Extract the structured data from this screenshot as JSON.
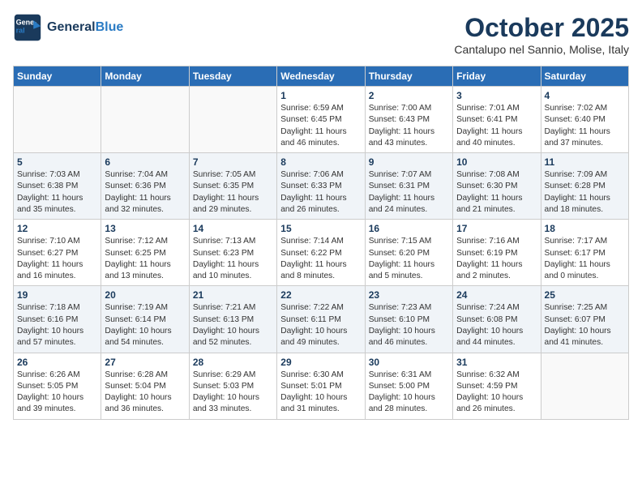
{
  "header": {
    "logo_line1": "General",
    "logo_line2": "Blue",
    "month": "October 2025",
    "location": "Cantalupo nel Sannio, Molise, Italy"
  },
  "weekdays": [
    "Sunday",
    "Monday",
    "Tuesday",
    "Wednesday",
    "Thursday",
    "Friday",
    "Saturday"
  ],
  "weeks": [
    [
      {
        "day": "",
        "detail": ""
      },
      {
        "day": "",
        "detail": ""
      },
      {
        "day": "",
        "detail": ""
      },
      {
        "day": "1",
        "detail": "Sunrise: 6:59 AM\nSunset: 6:45 PM\nDaylight: 11 hours\nand 46 minutes."
      },
      {
        "day": "2",
        "detail": "Sunrise: 7:00 AM\nSunset: 6:43 PM\nDaylight: 11 hours\nand 43 minutes."
      },
      {
        "day": "3",
        "detail": "Sunrise: 7:01 AM\nSunset: 6:41 PM\nDaylight: 11 hours\nand 40 minutes."
      },
      {
        "day": "4",
        "detail": "Sunrise: 7:02 AM\nSunset: 6:40 PM\nDaylight: 11 hours\nand 37 minutes."
      }
    ],
    [
      {
        "day": "5",
        "detail": "Sunrise: 7:03 AM\nSunset: 6:38 PM\nDaylight: 11 hours\nand 35 minutes."
      },
      {
        "day": "6",
        "detail": "Sunrise: 7:04 AM\nSunset: 6:36 PM\nDaylight: 11 hours\nand 32 minutes."
      },
      {
        "day": "7",
        "detail": "Sunrise: 7:05 AM\nSunset: 6:35 PM\nDaylight: 11 hours\nand 29 minutes."
      },
      {
        "day": "8",
        "detail": "Sunrise: 7:06 AM\nSunset: 6:33 PM\nDaylight: 11 hours\nand 26 minutes."
      },
      {
        "day": "9",
        "detail": "Sunrise: 7:07 AM\nSunset: 6:31 PM\nDaylight: 11 hours\nand 24 minutes."
      },
      {
        "day": "10",
        "detail": "Sunrise: 7:08 AM\nSunset: 6:30 PM\nDaylight: 11 hours\nand 21 minutes."
      },
      {
        "day": "11",
        "detail": "Sunrise: 7:09 AM\nSunset: 6:28 PM\nDaylight: 11 hours\nand 18 minutes."
      }
    ],
    [
      {
        "day": "12",
        "detail": "Sunrise: 7:10 AM\nSunset: 6:27 PM\nDaylight: 11 hours\nand 16 minutes."
      },
      {
        "day": "13",
        "detail": "Sunrise: 7:12 AM\nSunset: 6:25 PM\nDaylight: 11 hours\nand 13 minutes."
      },
      {
        "day": "14",
        "detail": "Sunrise: 7:13 AM\nSunset: 6:23 PM\nDaylight: 11 hours\nand 10 minutes."
      },
      {
        "day": "15",
        "detail": "Sunrise: 7:14 AM\nSunset: 6:22 PM\nDaylight: 11 hours\nand 8 minutes."
      },
      {
        "day": "16",
        "detail": "Sunrise: 7:15 AM\nSunset: 6:20 PM\nDaylight: 11 hours\nand 5 minutes."
      },
      {
        "day": "17",
        "detail": "Sunrise: 7:16 AM\nSunset: 6:19 PM\nDaylight: 11 hours\nand 2 minutes."
      },
      {
        "day": "18",
        "detail": "Sunrise: 7:17 AM\nSunset: 6:17 PM\nDaylight: 11 hours\nand 0 minutes."
      }
    ],
    [
      {
        "day": "19",
        "detail": "Sunrise: 7:18 AM\nSunset: 6:16 PM\nDaylight: 10 hours\nand 57 minutes."
      },
      {
        "day": "20",
        "detail": "Sunrise: 7:19 AM\nSunset: 6:14 PM\nDaylight: 10 hours\nand 54 minutes."
      },
      {
        "day": "21",
        "detail": "Sunrise: 7:21 AM\nSunset: 6:13 PM\nDaylight: 10 hours\nand 52 minutes."
      },
      {
        "day": "22",
        "detail": "Sunrise: 7:22 AM\nSunset: 6:11 PM\nDaylight: 10 hours\nand 49 minutes."
      },
      {
        "day": "23",
        "detail": "Sunrise: 7:23 AM\nSunset: 6:10 PM\nDaylight: 10 hours\nand 46 minutes."
      },
      {
        "day": "24",
        "detail": "Sunrise: 7:24 AM\nSunset: 6:08 PM\nDaylight: 10 hours\nand 44 minutes."
      },
      {
        "day": "25",
        "detail": "Sunrise: 7:25 AM\nSunset: 6:07 PM\nDaylight: 10 hours\nand 41 minutes."
      }
    ],
    [
      {
        "day": "26",
        "detail": "Sunrise: 6:26 AM\nSunset: 5:05 PM\nDaylight: 10 hours\nand 39 minutes."
      },
      {
        "day": "27",
        "detail": "Sunrise: 6:28 AM\nSunset: 5:04 PM\nDaylight: 10 hours\nand 36 minutes."
      },
      {
        "day": "28",
        "detail": "Sunrise: 6:29 AM\nSunset: 5:03 PM\nDaylight: 10 hours\nand 33 minutes."
      },
      {
        "day": "29",
        "detail": "Sunrise: 6:30 AM\nSunset: 5:01 PM\nDaylight: 10 hours\nand 31 minutes."
      },
      {
        "day": "30",
        "detail": "Sunrise: 6:31 AM\nSunset: 5:00 PM\nDaylight: 10 hours\nand 28 minutes."
      },
      {
        "day": "31",
        "detail": "Sunrise: 6:32 AM\nSunset: 4:59 PM\nDaylight: 10 hours\nand 26 minutes."
      },
      {
        "day": "",
        "detail": ""
      }
    ]
  ]
}
